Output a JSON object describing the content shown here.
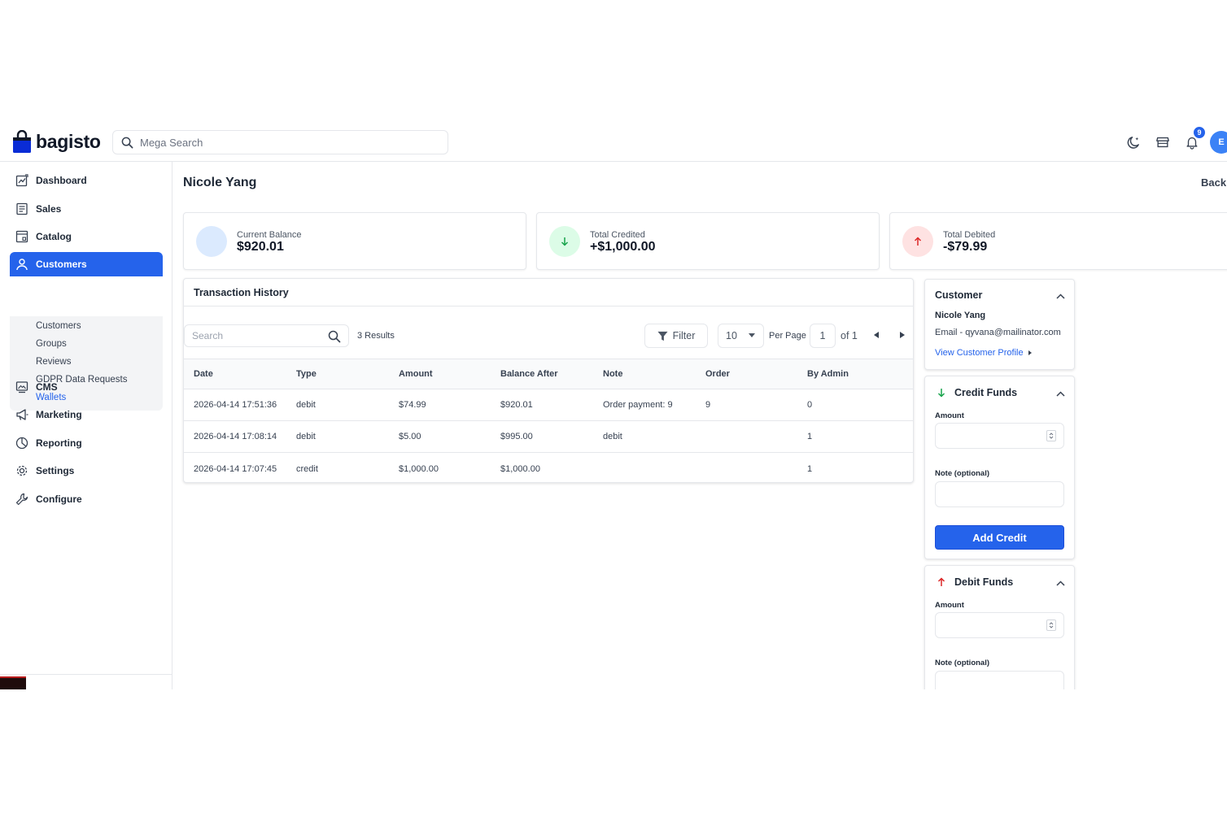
{
  "header": {
    "brand": "bagisto",
    "search_placeholder": "Mega Search",
    "notification_count": "9",
    "avatar_initial": "E"
  },
  "sidebar": {
    "items": [
      {
        "label": "Dashboard",
        "icon": "dashboard-icon"
      },
      {
        "label": "Sales",
        "icon": "sales-icon"
      },
      {
        "label": "Catalog",
        "icon": "catalog-icon"
      },
      {
        "label": "Customers",
        "icon": "customers-icon",
        "active": true
      },
      {
        "label": "CMS",
        "icon": "cms-icon"
      },
      {
        "label": "Marketing",
        "icon": "marketing-icon"
      },
      {
        "label": "Reporting",
        "icon": "reporting-icon"
      },
      {
        "label": "Settings",
        "icon": "settings-icon"
      },
      {
        "label": "Configure",
        "icon": "configure-icon"
      }
    ],
    "customers_sub": [
      "Customers",
      "Groups",
      "Reviews",
      "GDPR Data Requests",
      "Wallets"
    ]
  },
  "page": {
    "title": "Nicole Yang",
    "back_label": "Back"
  },
  "stats": {
    "current_balance": {
      "label": "Current Balance",
      "value": "$920.01"
    },
    "total_credited": {
      "label": "Total Credited",
      "value": "+$1,000.00"
    },
    "total_debited": {
      "label": "Total Debited",
      "value": "-$79.99"
    }
  },
  "history": {
    "title": "Transaction History",
    "search_placeholder": "Search",
    "results": "3 Results",
    "filter_label": "Filter",
    "per_page_value": "10",
    "per_page_label": "Per Page",
    "page_value": "1",
    "page_of": "of 1",
    "columns": [
      "Date",
      "Type",
      "Amount",
      "Balance After",
      "Note",
      "Order",
      "By Admin"
    ],
    "rows": [
      [
        "2026-04-14 17:51:36",
        "debit",
        "$74.99",
        "$920.01",
        "Order payment: 9",
        "9",
        "0"
      ],
      [
        "2026-04-14 17:08:14",
        "debit",
        "$5.00",
        "$995.00",
        "debit",
        "",
        "1"
      ],
      [
        "2026-04-14 17:07:45",
        "credit",
        "$1,000.00",
        "$1,000.00",
        "",
        "",
        "1"
      ]
    ]
  },
  "customer_panel": {
    "title": "Customer",
    "name": "Nicole Yang",
    "email": "Email - qyvana@mailinator.com",
    "profile_link": "View Customer Profile"
  },
  "credit_panel": {
    "title": "Credit Funds",
    "amount_label": "Amount",
    "note_label": "Note (optional)",
    "button_label": "Add Credit"
  },
  "debit_panel": {
    "title": "Debit Funds",
    "amount_label": "Amount",
    "note_label": "Note (optional)"
  },
  "colors": {
    "primary": "#2563eb",
    "credit_green": "#16a34a",
    "debit_red": "#dc2626"
  }
}
